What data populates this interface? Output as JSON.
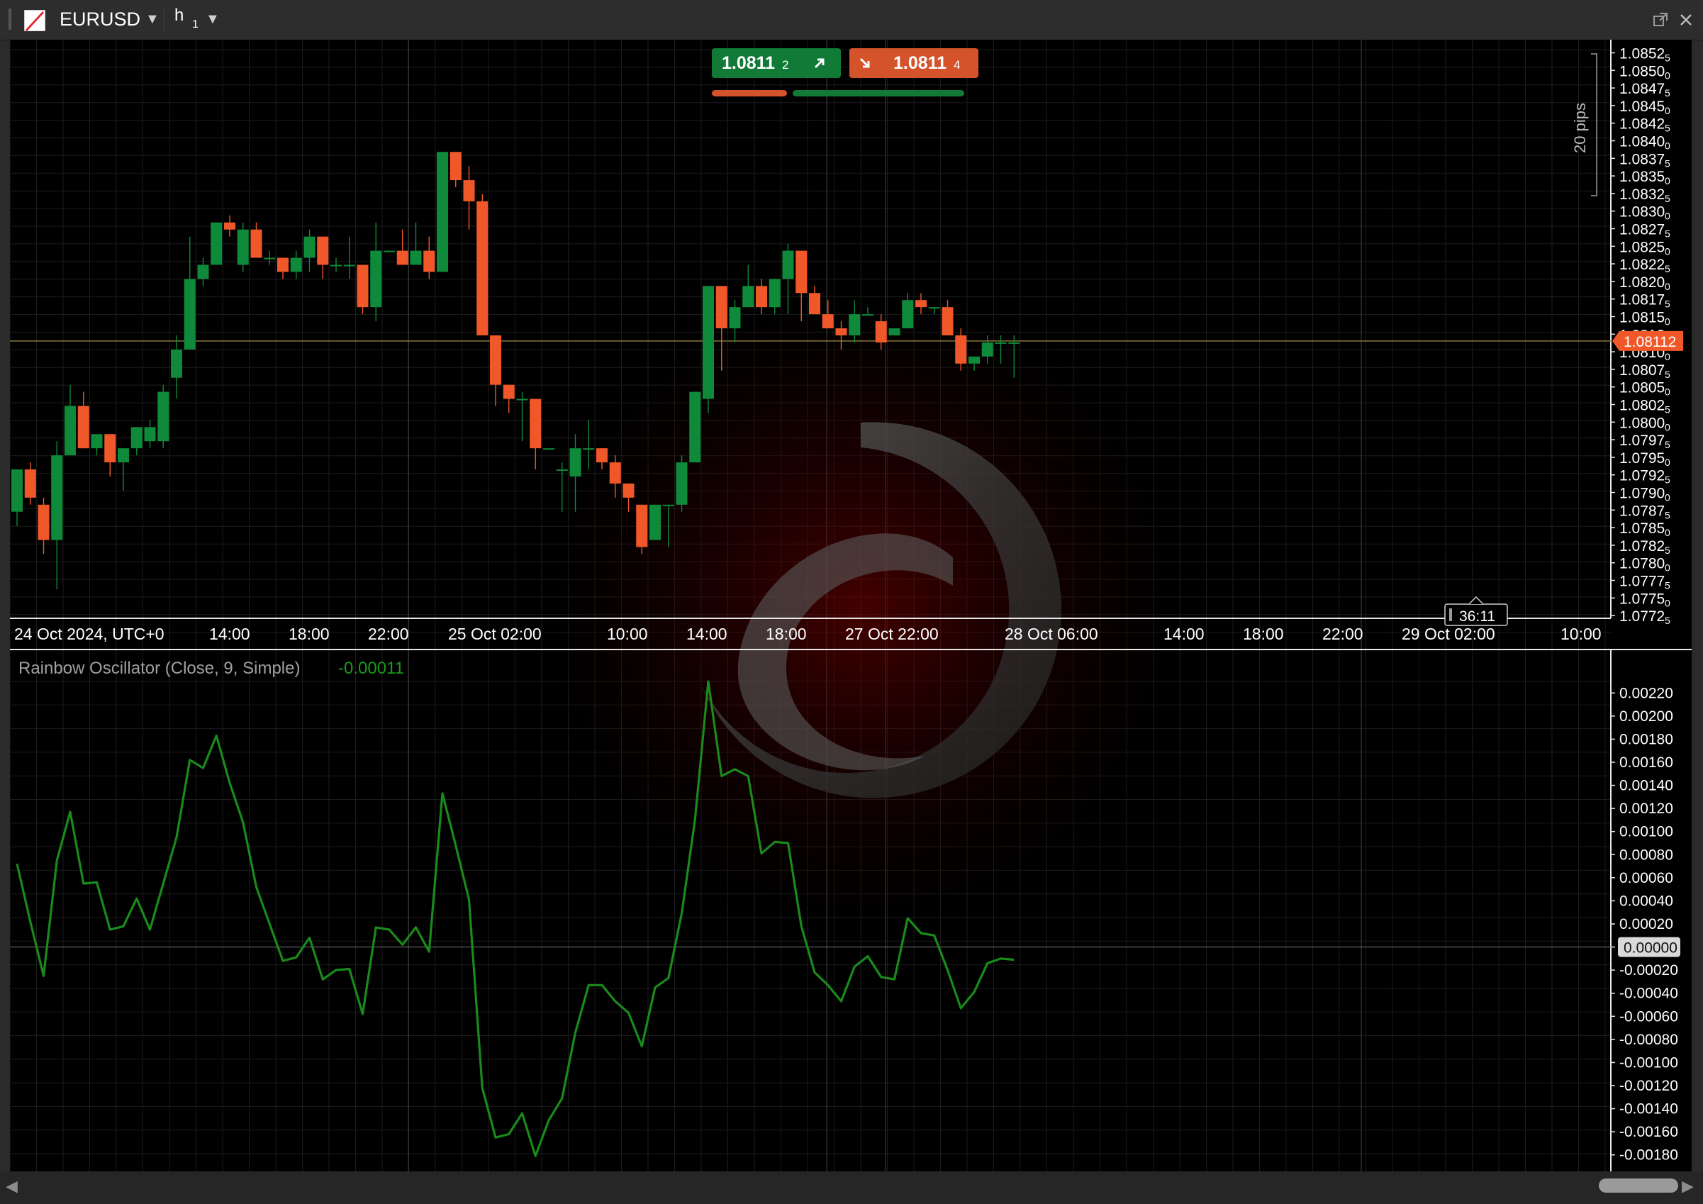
{
  "title_bar": {
    "symbol": "EURUSD",
    "timeframe": "h",
    "timeframe_sub": "1"
  },
  "trade": {
    "buy_price_main": "1.0811",
    "buy_price_pip": "2",
    "sell_price_main": "1.0811",
    "sell_price_pip": "4",
    "spread_left_fraction": 0.31,
    "spread_right_fraction": 0.69
  },
  "price_axis": {
    "labels": [
      "1.0852",
      "1.0850",
      "1.0847",
      "1.0845",
      "1.0842",
      "1.0840",
      "1.0837",
      "1.0835",
      "1.0832",
      "1.0830",
      "1.0827",
      "1.0825",
      "1.0822",
      "1.0820",
      "1.0817",
      "1.0815",
      "1.0812",
      "1.0810",
      "1.0807",
      "1.0805",
      "1.0802",
      "1.0800",
      "1.0797",
      "1.0795",
      "1.0792",
      "1.0790",
      "1.0787",
      "1.0785",
      "1.0782",
      "1.0780",
      "1.0777",
      "1.0775",
      "1.0772"
    ],
    "subs": [
      "5",
      "0",
      "5",
      "0",
      "5",
      "0",
      "5",
      "0",
      "5",
      "0",
      "5",
      "0",
      "5",
      "0",
      "5",
      "0",
      "5",
      "0",
      "5",
      "0",
      "5",
      "0",
      "5",
      "0",
      "5",
      "0",
      "5",
      "0",
      "5",
      "0",
      "5",
      "0",
      "5"
    ],
    "current_price": "1.08112",
    "pips_label": "20 pips"
  },
  "time_axis": {
    "labels": [
      "24 Oct 2024, UTC+0",
      "14:00",
      "18:00",
      "22:00",
      "25 Oct 02:00",
      "10:00",
      "14:00",
      "18:00",
      "27 Oct 22:00",
      "28 Oct 06:00",
      "14:00",
      "18:00",
      "22:00",
      "29 Oct 02:00",
      "10:00"
    ],
    "countdown": "36:11"
  },
  "indicator": {
    "name": "Rainbow Oscillator (Close, 9, Simple)",
    "value": "-0.00011",
    "axis_labels": [
      "0.00220",
      "0.00200",
      "0.00180",
      "0.00160",
      "0.00140",
      "0.00120",
      "0.00100",
      "0.00080",
      "0.00060",
      "0.00040",
      "0.00020",
      "0.00000",
      "-0.00020",
      "-0.00040",
      "-0.00060",
      "-0.00080",
      "-0.00100",
      "-0.00120",
      "-0.00140",
      "-0.00160",
      "-0.00180"
    ],
    "zero_label": "0.00000"
  },
  "colors": {
    "bull": "#0e8a3a",
    "bear": "#f0582a",
    "oscillator": "#1a8a1a",
    "price_line": "#8a7a3a"
  },
  "chart_data": [
    {
      "type": "candlestick",
      "title": "EURUSD h1",
      "ylim": [
        1.07725,
        1.08525
      ],
      "candles": [
        {
          "o": 1.0787,
          "h": 1.079,
          "l": 1.0785,
          "c": 1.0793
        },
        {
          "o": 1.0793,
          "h": 1.0794,
          "l": 1.0788,
          "c": 1.0789
        },
        {
          "o": 1.0788,
          "h": 1.0789,
          "l": 1.0781,
          "c": 1.0783
        },
        {
          "o": 1.0783,
          "h": 1.0797,
          "l": 1.0776,
          "c": 1.0795
        },
        {
          "o": 1.0795,
          "h": 1.0805,
          "l": 1.0795,
          "c": 1.0802
        },
        {
          "o": 1.0802,
          "h": 1.0804,
          "l": 1.0796,
          "c": 1.0796
        },
        {
          "o": 1.0796,
          "h": 1.0798,
          "l": 1.0795,
          "c": 1.0798
        },
        {
          "o": 1.0798,
          "h": 1.0798,
          "l": 1.0792,
          "c": 1.0794
        },
        {
          "o": 1.0794,
          "h": 1.0796,
          "l": 1.079,
          "c": 1.0796
        },
        {
          "o": 1.0796,
          "h": 1.0799,
          "l": 1.0795,
          "c": 1.0799
        },
        {
          "o": 1.0797,
          "h": 1.08,
          "l": 1.0796,
          "c": 1.0799
        },
        {
          "o": 1.0797,
          "h": 1.0805,
          "l": 1.0796,
          "c": 1.0804
        },
        {
          "o": 1.0806,
          "h": 1.0812,
          "l": 1.0803,
          "c": 1.081
        },
        {
          "o": 1.081,
          "h": 1.0826,
          "l": 1.081,
          "c": 1.082
        },
        {
          "o": 1.082,
          "h": 1.0823,
          "l": 1.0819,
          "c": 1.0822
        },
        {
          "o": 1.0822,
          "h": 1.0828,
          "l": 1.0822,
          "c": 1.0828
        },
        {
          "o": 1.0828,
          "h": 1.0829,
          "l": 1.0826,
          "c": 1.0827
        },
        {
          "o": 1.0822,
          "h": 1.0828,
          "l": 1.0821,
          "c": 1.0827
        },
        {
          "o": 1.0827,
          "h": 1.0828,
          "l": 1.0823,
          "c": 1.0823
        },
        {
          "o": 1.0823,
          "h": 1.0824,
          "l": 1.0822,
          "c": 1.0823
        },
        {
          "o": 1.0823,
          "h": 1.0823,
          "l": 1.082,
          "c": 1.0821
        },
        {
          "o": 1.0821,
          "h": 1.0824,
          "l": 1.082,
          "c": 1.0823
        },
        {
          "o": 1.0823,
          "h": 1.0827,
          "l": 1.0821,
          "c": 1.0826
        },
        {
          "o": 1.0826,
          "h": 1.0826,
          "l": 1.082,
          "c": 1.0822
        },
        {
          "o": 1.0822,
          "h": 1.0823,
          "l": 1.0821,
          "c": 1.0822
        },
        {
          "o": 1.0822,
          "h": 1.0826,
          "l": 1.082,
          "c": 1.0822
        },
        {
          "o": 1.0822,
          "h": 1.0822,
          "l": 1.0815,
          "c": 1.0816
        },
        {
          "o": 1.0816,
          "h": 1.0828,
          "l": 1.0814,
          "c": 1.0824
        },
        {
          "o": 1.0824,
          "h": 1.0824,
          "l": 1.0824,
          "c": 1.0824
        },
        {
          "o": 1.0824,
          "h": 1.0827,
          "l": 1.0822,
          "c": 1.0822
        },
        {
          "o": 1.0822,
          "h": 1.0828,
          "l": 1.0822,
          "c": 1.0824
        },
        {
          "o": 1.0824,
          "h": 1.0826,
          "l": 1.082,
          "c": 1.0821
        },
        {
          "o": 1.0821,
          "h": 1.0838,
          "l": 1.0821,
          "c": 1.0838
        },
        {
          "o": 1.0838,
          "h": 1.0838,
          "l": 1.0833,
          "c": 1.0834
        },
        {
          "o": 1.0834,
          "h": 1.0836,
          "l": 1.0827,
          "c": 1.0831
        },
        {
          "o": 1.0831,
          "h": 1.0832,
          "l": 1.0813,
          "c": 1.0812
        },
        {
          "o": 1.0812,
          "h": 1.0812,
          "l": 1.0802,
          "c": 1.0805
        },
        {
          "o": 1.0805,
          "h": 1.0805,
          "l": 1.0801,
          "c": 1.0803
        },
        {
          "o": 1.0803,
          "h": 1.0804,
          "l": 1.0797,
          "c": 1.0803
        },
        {
          "o": 1.0803,
          "h": 1.0803,
          "l": 1.0793,
          "c": 1.0796
        },
        {
          "o": 1.0796,
          "h": 1.0796,
          "l": 1.0796,
          "c": 1.0796
        },
        {
          "o": 1.0793,
          "h": 1.0794,
          "l": 1.0787,
          "c": 1.0793
        },
        {
          "o": 1.0792,
          "h": 1.0798,
          "l": 1.0787,
          "c": 1.0796
        },
        {
          "o": 1.0796,
          "h": 1.08,
          "l": 1.0793,
          "c": 1.0796
        },
        {
          "o": 1.0796,
          "h": 1.0796,
          "l": 1.0793,
          "c": 1.0794
        },
        {
          "o": 1.0794,
          "h": 1.0795,
          "l": 1.0789,
          "c": 1.0791
        },
        {
          "o": 1.0791,
          "h": 1.0791,
          "l": 1.0787,
          "c": 1.0789
        },
        {
          "o": 1.0788,
          "h": 1.0788,
          "l": 1.0781,
          "c": 1.0782
        },
        {
          "o": 1.0783,
          "h": 1.0788,
          "l": 1.0783,
          "c": 1.0788
        },
        {
          "o": 1.0788,
          "h": 1.0788,
          "l": 1.0782,
          "c": 1.0788
        },
        {
          "o": 1.0788,
          "h": 1.0795,
          "l": 1.0787,
          "c": 1.0794
        },
        {
          "o": 1.0794,
          "h": 1.0804,
          "l": 1.0794,
          "c": 1.0804
        },
        {
          "o": 1.0803,
          "h": 1.0819,
          "l": 1.0801,
          "c": 1.0819
        },
        {
          "o": 1.0819,
          "h": 1.0819,
          "l": 1.0807,
          "c": 1.0813
        },
        {
          "o": 1.0813,
          "h": 1.0817,
          "l": 1.0811,
          "c": 1.0816
        },
        {
          "o": 1.0816,
          "h": 1.0822,
          "l": 1.0816,
          "c": 1.0819
        },
        {
          "o": 1.0819,
          "h": 1.082,
          "l": 1.0815,
          "c": 1.0816
        },
        {
          "o": 1.0816,
          "h": 1.082,
          "l": 1.0815,
          "c": 1.082
        },
        {
          "o": 1.082,
          "h": 1.0825,
          "l": 1.0815,
          "c": 1.0824
        },
        {
          "o": 1.0824,
          "h": 1.0824,
          "l": 1.0814,
          "c": 1.0818
        },
        {
          "o": 1.0818,
          "h": 1.0819,
          "l": 1.0816,
          "c": 1.0815
        },
        {
          "o": 1.0815,
          "h": 1.0817,
          "l": 1.0813,
          "c": 1.0813
        },
        {
          "o": 1.0813,
          "h": 1.0814,
          "l": 1.081,
          "c": 1.0812
        },
        {
          "o": 1.0812,
          "h": 1.0817,
          "l": 1.0811,
          "c": 1.0815
        },
        {
          "o": 1.0815,
          "h": 1.0816,
          "l": 1.0815,
          "c": 1.0815
        },
        {
          "o": 1.0814,
          "h": 1.0815,
          "l": 1.081,
          "c": 1.0811
        },
        {
          "o": 1.0812,
          "h": 1.0813,
          "l": 1.0812,
          "c": 1.0813
        },
        {
          "o": 1.0813,
          "h": 1.0818,
          "l": 1.0813,
          "c": 1.0817
        },
        {
          "o": 1.0817,
          "h": 1.0818,
          "l": 1.0815,
          "c": 1.0816
        },
        {
          "o": 1.0816,
          "h": 1.0816,
          "l": 1.0815,
          "c": 1.0816
        },
        {
          "o": 1.0816,
          "h": 1.0817,
          "l": 1.0812,
          "c": 1.0812
        },
        {
          "o": 1.0812,
          "h": 1.0813,
          "l": 1.0807,
          "c": 1.0808
        },
        {
          "o": 1.0808,
          "h": 1.0809,
          "l": 1.0807,
          "c": 1.0809
        },
        {
          "o": 1.0809,
          "h": 1.0812,
          "l": 1.0808,
          "c": 1.0811
        },
        {
          "o": 1.0811,
          "h": 1.0812,
          "l": 1.0808,
          "c": 1.0811
        },
        {
          "o": 1.0811,
          "h": 1.0812,
          "l": 1.0806,
          "c": 1.0811
        }
      ]
    },
    {
      "type": "line",
      "title": "Rainbow Oscillator (Close, 9, Simple)",
      "ylim": [
        -0.0019,
        0.0023
      ],
      "series": [
        {
          "name": "Rainbow Oscillator (Close, 9, Simple)",
          "values": [
            0.00072,
            0.00022,
            -0.00025,
            0.00075,
            0.00117,
            0.00055,
            0.00056,
            0.00015,
            0.00018,
            0.00042,
            0.00015,
            0.00055,
            0.00095,
            0.00162,
            0.00155,
            0.00183,
            0.00142,
            0.00108,
            0.00052,
            0.0002,
            -0.00012,
            -9e-05,
            8e-05,
            -0.00028,
            -0.0002,
            -0.00019,
            -0.00058,
            0.00017,
            0.00015,
            2e-05,
            0.00017,
            -4e-05,
            0.00133,
            0.00088,
            0.00041,
            -0.00122,
            -0.00165,
            -0.00162,
            -0.00144,
            -0.00181,
            -0.0015,
            -0.00131,
            -0.00074,
            -0.00033,
            -0.00033,
            -0.00047,
            -0.00057,
            -0.00086,
            -0.00035,
            -0.00027,
            0.00029,
            0.0011,
            0.0023,
            0.00148,
            0.00154,
            0.00148,
            0.00081,
            0.00091,
            0.0009,
            0.00018,
            -0.00022,
            -0.00033,
            -0.00047,
            -0.00017,
            -8e-05,
            -0.00026,
            -0.00028,
            0.00025,
            0.00012,
            0.0001,
            -0.0002,
            -0.00053,
            -0.00039,
            -0.00014,
            -0.0001,
            -0.00011
          ]
        }
      ]
    }
  ]
}
